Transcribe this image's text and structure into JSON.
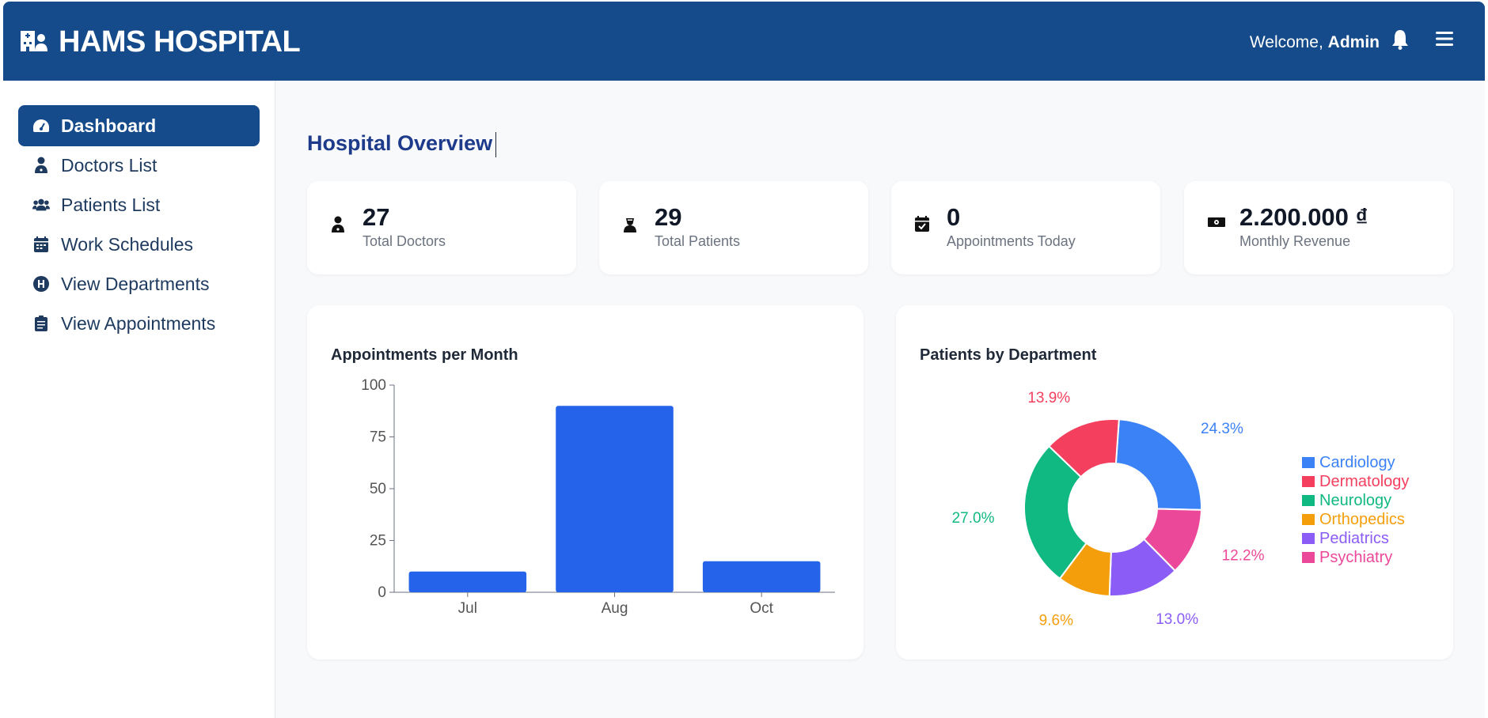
{
  "header": {
    "brand": "HAMS HOSPITAL",
    "welcome_prefix": "Welcome,",
    "user": "Admin"
  },
  "sidebar": {
    "items": [
      {
        "label": "Dashboard",
        "icon": "gauge-icon",
        "active": true
      },
      {
        "label": "Doctors List",
        "icon": "doctor-icon"
      },
      {
        "label": "Patients List",
        "icon": "users-icon"
      },
      {
        "label": "Work Schedules",
        "icon": "calendar-icon"
      },
      {
        "label": "View Departments",
        "icon": "hospital-h-icon"
      },
      {
        "label": "View Appointments",
        "icon": "clipboard-icon"
      }
    ]
  },
  "main": {
    "title": "Hospital Overview",
    "stats": [
      {
        "value": "27",
        "label": "Total Doctors",
        "icon": "doctor-icon"
      },
      {
        "value": "29",
        "label": "Total Patients",
        "icon": "patient-icon"
      },
      {
        "value": "0",
        "label": "Appointments Today",
        "icon": "calendar-check-icon"
      },
      {
        "value": "2.200.000 ₫",
        "label": "Monthly Revenue",
        "icon": "money-icon"
      }
    ]
  },
  "chart_data": [
    {
      "type": "bar",
      "title": "Appointments per Month",
      "categories": [
        "Jul",
        "Aug",
        "Oct"
      ],
      "values": [
        10,
        90,
        15
      ],
      "ylim": [
        0,
        100
      ],
      "yticks": [
        0,
        25,
        50,
        75,
        100
      ],
      "color": "#2563eb"
    },
    {
      "type": "pie",
      "title": "Patients by Department",
      "labels": [
        "Cardiology",
        "Psychiatry",
        "Pediatrics",
        "Orthopedics",
        "Neurology",
        "Dermatology"
      ],
      "values": [
        24.3,
        12.2,
        13.0,
        9.6,
        27.0,
        13.9
      ],
      "value_labels": [
        "24.3%",
        "12.2%",
        "13.0%",
        "9.6%",
        "27.0%",
        "13.9%"
      ],
      "colors": [
        "#3b82f6",
        "#ec4899",
        "#8b5cf6",
        "#f59e0b",
        "#10b981",
        "#f43f5e"
      ],
      "legend": [
        {
          "label": "Cardiology",
          "color": "#3b82f6"
        },
        {
          "label": "Dermatology",
          "color": "#f43f5e"
        },
        {
          "label": "Neurology",
          "color": "#10b981"
        },
        {
          "label": "Orthopedics",
          "color": "#f59e0b"
        },
        {
          "label": "Pediatrics",
          "color": "#8b5cf6"
        },
        {
          "label": "Psychiatry",
          "color": "#ec4899"
        }
      ],
      "legend_position": "right"
    }
  ]
}
